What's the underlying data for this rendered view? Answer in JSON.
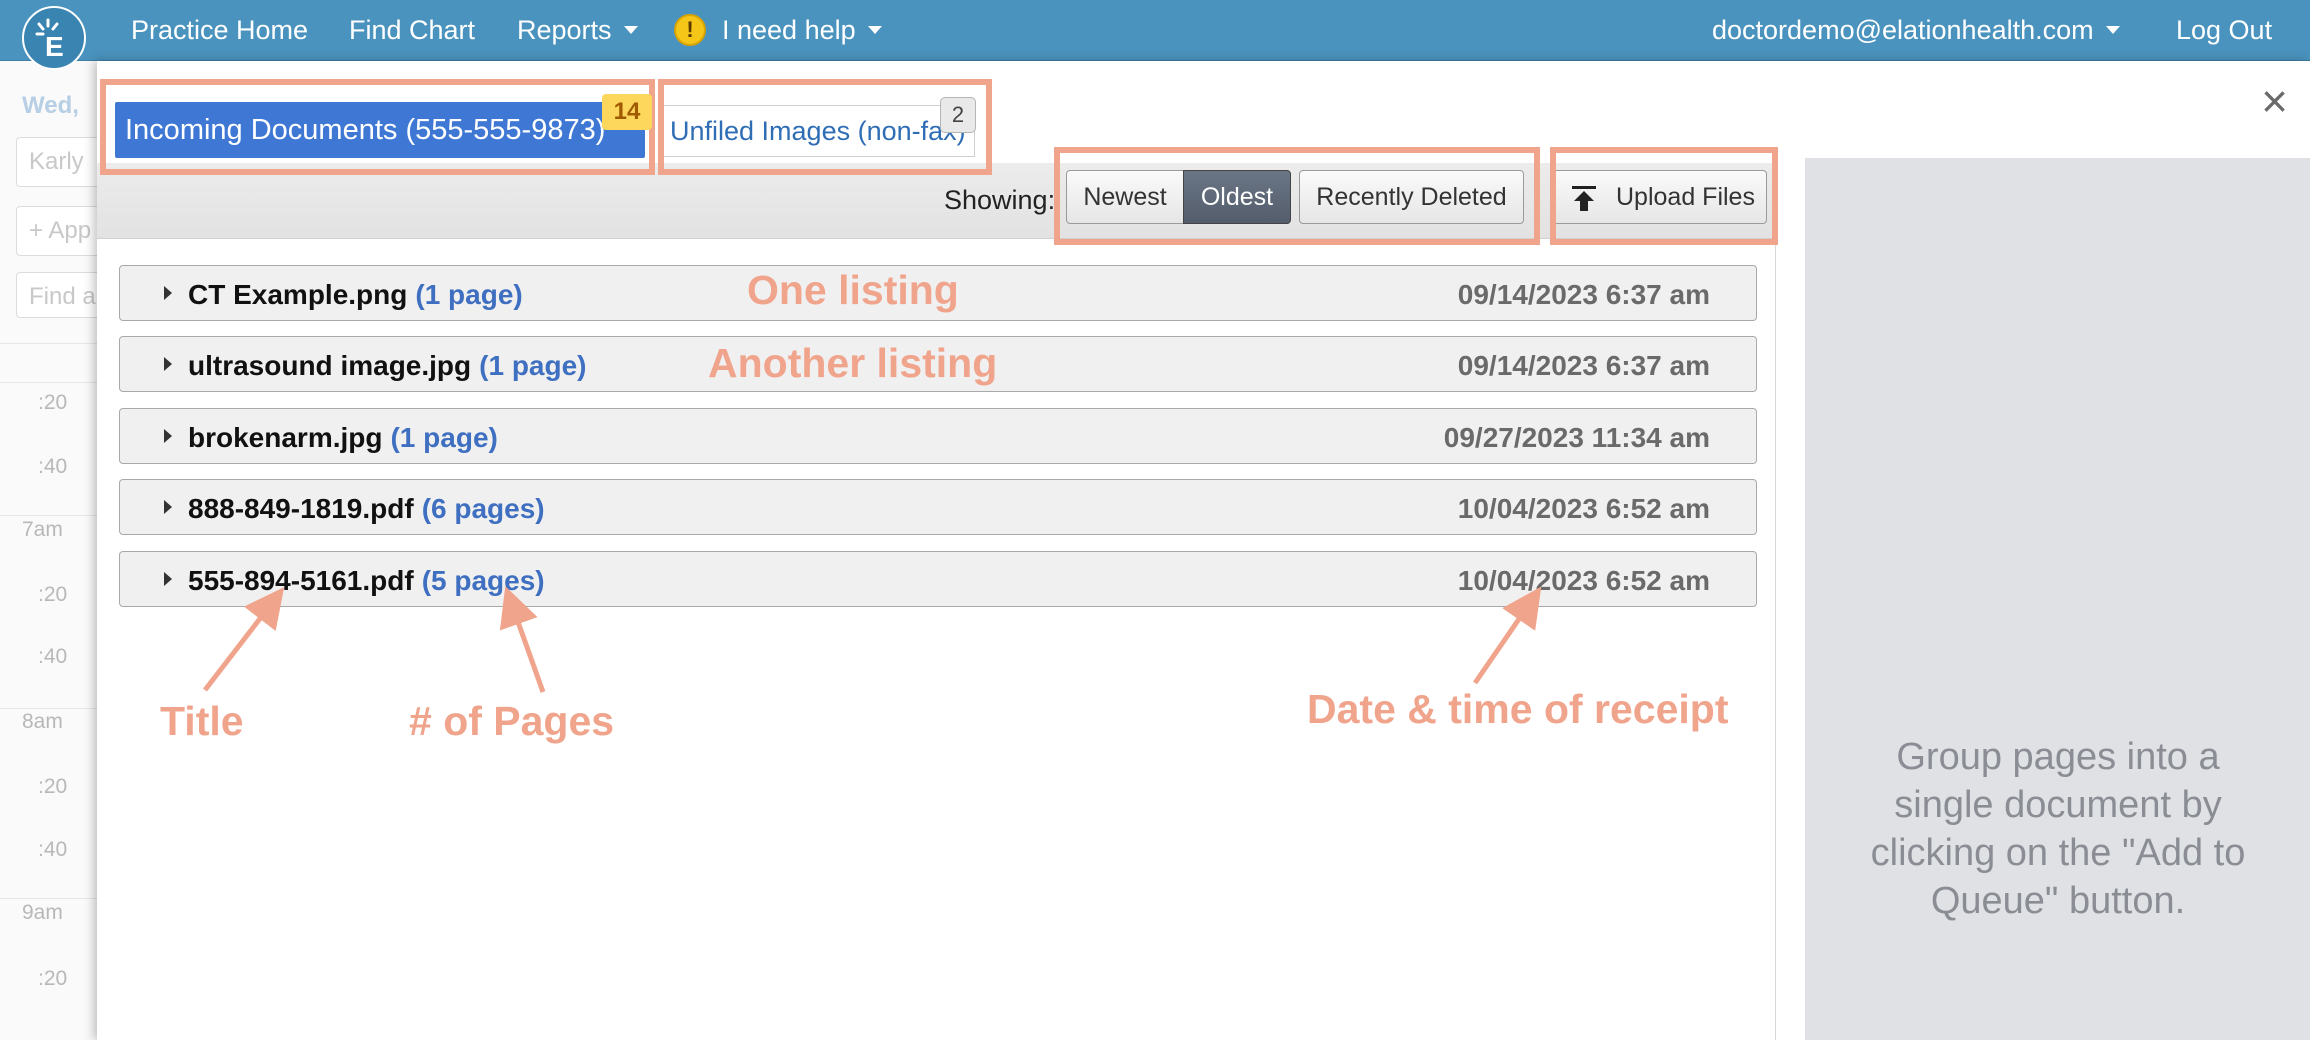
{
  "topnav": {
    "practice_home": "Practice Home",
    "find_chart": "Find Chart",
    "reports": "Reports",
    "help": "I need help",
    "user_email": "doctordemo@elationhealth.com",
    "logout": "Log Out"
  },
  "background": {
    "date": "Wed,",
    "search_value": "Karly",
    "add_appt": "+ App",
    "find_placeholder": "Find a",
    "times": [
      ":20",
      ":40",
      "7am",
      ":20",
      ":40",
      "8am",
      ":20",
      ":40",
      "9am",
      ":20"
    ]
  },
  "modal": {
    "close": "×",
    "tabs": [
      {
        "label": "Incoming Documents (555-555-9873)",
        "badge": "14"
      },
      {
        "label": "Unfiled Images (non-fax)",
        "badge": "2"
      }
    ],
    "toolbar": {
      "showing_label": "Showing:",
      "newest": "Newest",
      "oldest": "Oldest",
      "recently_deleted": "Recently Deleted",
      "upload": "Upload Files"
    },
    "documents": [
      {
        "title": "CT Example.png",
        "pages": "(1 page)",
        "date": "09/14/2023 6:37 am"
      },
      {
        "title": "ultrasound image.jpg",
        "pages": "(1 page)",
        "date": "09/14/2023 6:37 am"
      },
      {
        "title": "brokenarm.jpg",
        "pages": "(1 page)",
        "date": "09/27/2023 11:34 am"
      },
      {
        "title": "888-849-1819.pdf",
        "pages": "(6 pages)",
        "date": "10/04/2023 6:52 am"
      },
      {
        "title": "555-894-5161.pdf",
        "pages": "(5 pages)",
        "date": "10/04/2023 6:52 am"
      }
    ],
    "side_panel_text": "Group pages into a single document by clicking on the \"Add to Queue\" button."
  },
  "annotations": {
    "one_listing": "One listing",
    "another_listing": "Another listing",
    "title": "Title",
    "num_pages": "# of Pages",
    "date_time": "Date & time of receipt"
  },
  "colors": {
    "nav_bg": "#4a93be",
    "tab_active": "#3f78d4",
    "annotation": "#f0a48c",
    "page_count": "#3f6fc0"
  }
}
